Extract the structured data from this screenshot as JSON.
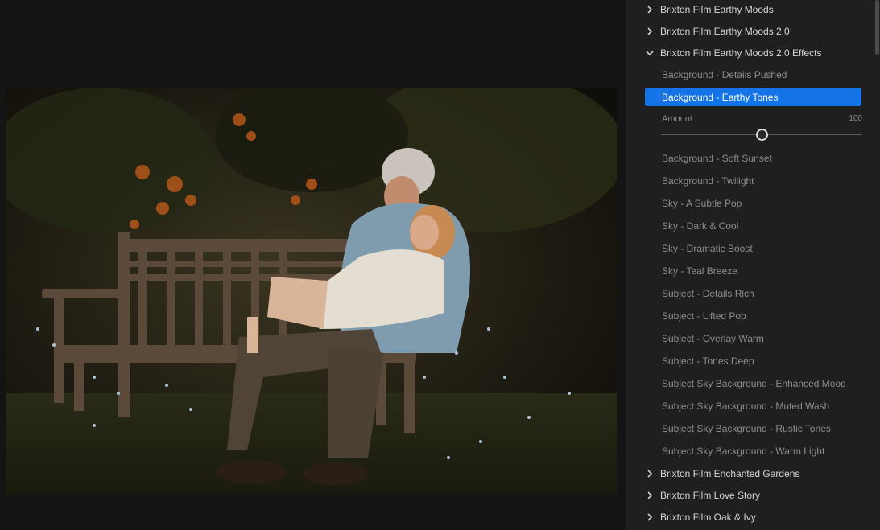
{
  "groups_top": [
    {
      "label": "Brixton Film Earthy Moods",
      "expanded": false
    },
    {
      "label": "Brixton Film Earthy Moods 2.0",
      "expanded": false
    },
    {
      "label": "Brixton Film Earthy Moods 2.0 Effects",
      "expanded": true
    }
  ],
  "presets": [
    {
      "label": "Background - Details Pushed"
    },
    {
      "label": "Background - Earthy Tones",
      "selected": true
    },
    {
      "label": "Background - Soft Sunset"
    },
    {
      "label": "Background - Twilight"
    },
    {
      "label": "Sky - A Subtle Pop"
    },
    {
      "label": "Sky - Dark & Cool"
    },
    {
      "label": "Sky - Dramatic Boost"
    },
    {
      "label": "Sky - Teal Breeze"
    },
    {
      "label": "Subject - Details Rich"
    },
    {
      "label": "Subject - Lifted Pop"
    },
    {
      "label": "Subject - Overlay Warm"
    },
    {
      "label": "Subject - Tones Deep"
    },
    {
      "label": "Subject Sky Background - Enhanced Mood"
    },
    {
      "label": "Subject Sky Background - Muted Wash"
    },
    {
      "label": "Subject Sky Background - Rustic Tones"
    },
    {
      "label": "Subject Sky Background - Warm Light"
    }
  ],
  "amount": {
    "label": "Amount",
    "value": "100",
    "fraction": 0.5
  },
  "groups_bottom": [
    {
      "label": "Brixton Film Enchanted Gardens",
      "expanded": false
    },
    {
      "label": "Brixton Film Love Story",
      "expanded": false
    },
    {
      "label": "Brixton Film Oak & Ivy",
      "expanded": false
    }
  ],
  "colors": {
    "accent": "#1473e6",
    "panel": "#1f1f1f",
    "canvas": "#141414"
  }
}
